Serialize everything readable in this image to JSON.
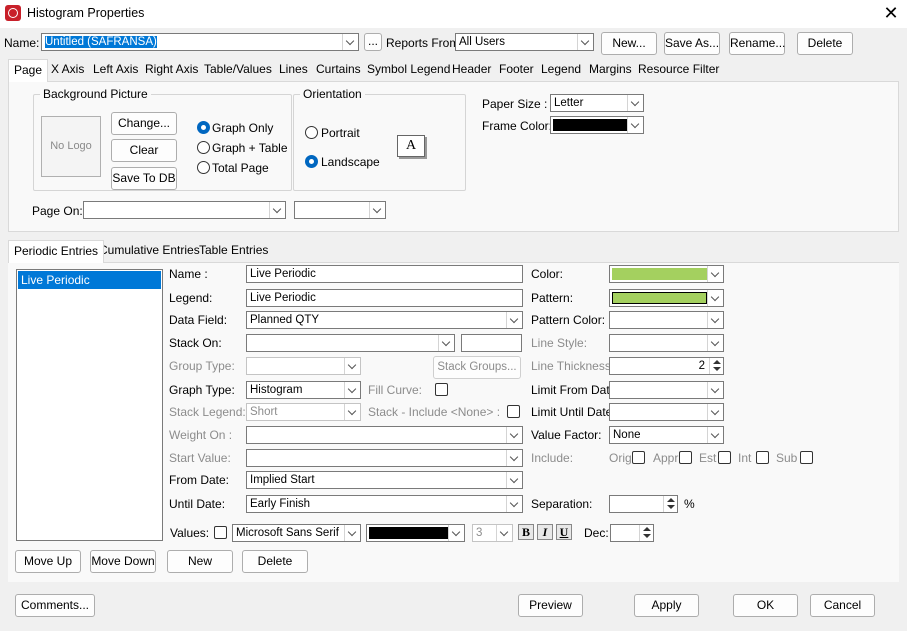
{
  "window": {
    "title": "Histogram Properties"
  },
  "top_bar": {
    "name_label": "Name:",
    "name_value": "Untitled (SAFRANSA)",
    "ellipsis": "...",
    "reports_from_label": "Reports From:",
    "reports_from_value": "All Users",
    "buttons": {
      "new": "New...",
      "save_as": "Save As...",
      "rename": "Rename...",
      "delete": "Delete"
    }
  },
  "main_tabs": [
    "Page",
    "X Axis",
    "Left Axis",
    "Right Axis",
    "Table/Values",
    "Lines",
    "Curtains",
    "Symbol Legend",
    "Header",
    "Footer",
    "Legend",
    "Margins",
    "Resource Filter"
  ],
  "page_tab": {
    "background_picture": {
      "title": "Background Picture",
      "no_logo": "No Logo",
      "change": "Change...",
      "clear": "Clear",
      "save_to_db": "Save To DB",
      "options": [
        {
          "label": "Graph Only",
          "selected": true
        },
        {
          "label": "Graph + Table",
          "selected": false
        },
        {
          "label": "Total Page",
          "selected": false
        }
      ]
    },
    "orientation": {
      "title": "Orientation",
      "options": [
        {
          "label": "Portrait",
          "selected": false
        },
        {
          "label": "Landscape",
          "selected": true
        }
      ],
      "icon_letter": "A"
    },
    "paper_size_label": "Paper Size :",
    "paper_size_value": "Letter",
    "frame_color_label": "Frame Color:",
    "frame_color": "#000000",
    "page_on_label": "Page On:",
    "page_on_value": "",
    "page_on_value2": ""
  },
  "entry_tabs": [
    "Periodic Entries",
    "Cumulative Entries",
    "Table Entries"
  ],
  "entries_list": [
    "Live Periodic"
  ],
  "entry_form": {
    "name": {
      "label": "Name :",
      "value": "Live Periodic"
    },
    "legend": {
      "label": "Legend:",
      "value": "Live Periodic"
    },
    "data_field": {
      "label": "Data Field:",
      "value": "Planned QTY"
    },
    "stack_on": {
      "label": "Stack On:",
      "value": "",
      "value2": ""
    },
    "group_type": {
      "label": "Group Type:",
      "value": ""
    },
    "stack_groups": "Stack Groups...",
    "graph_type": {
      "label": "Graph Type:",
      "value": "Histogram"
    },
    "fill_curve": {
      "label": "Fill Curve:",
      "checked": false
    },
    "stack_legend": {
      "label": "Stack Legend:",
      "value": "Short"
    },
    "stack_include_none": {
      "label": "Stack - Include <None> :",
      "checked": false
    },
    "weight_on": {
      "label": "Weight On :",
      "value": ""
    },
    "start_value": {
      "label": "Start Value:",
      "value": ""
    },
    "from_date": {
      "label": "From Date:",
      "value": "Implied Start"
    },
    "until_date": {
      "label": "Until Date:",
      "value": "Early Finish"
    },
    "values": {
      "label": "Values:",
      "checked": false,
      "font": "Microsoft Sans Serif",
      "color": "#000000",
      "size": "3",
      "bold": "B",
      "italic": "I",
      "underline": "U",
      "dec_label": "Dec:",
      "dec_value": ""
    },
    "color": {
      "label": "Color:",
      "value": "#a4d05f"
    },
    "pattern": {
      "label": "Pattern:",
      "value": "#a4d05f"
    },
    "pattern_color": {
      "label": "Pattern Color:",
      "value": ""
    },
    "line_style": {
      "label": "Line Style:",
      "value": ""
    },
    "line_thickness": {
      "label": "Line Thickness:",
      "value": "2"
    },
    "limit_from_date": {
      "label": "Limit From Date:",
      "value": ""
    },
    "limit_until_date": {
      "label": "Limit Until Date:",
      "value": ""
    },
    "value_factor": {
      "label": "Value Factor:",
      "value": "None"
    },
    "include": {
      "label": "Include:",
      "options": [
        {
          "label": "Orig",
          "checked": false
        },
        {
          "label": "Appr",
          "checked": false
        },
        {
          "label": "Est",
          "checked": false
        },
        {
          "label": "Int",
          "checked": false
        },
        {
          "label": "Sub",
          "checked": false
        }
      ]
    },
    "separation": {
      "label": "Separation:",
      "value": "",
      "unit": "%"
    }
  },
  "entry_buttons": {
    "move_up": "Move Up",
    "move_down": "Move Down",
    "new": "New",
    "delete": "Delete"
  },
  "footer_buttons": {
    "comments": "Comments...",
    "preview": "Preview",
    "apply": "Apply",
    "ok": "OK",
    "cancel": "Cancel"
  }
}
